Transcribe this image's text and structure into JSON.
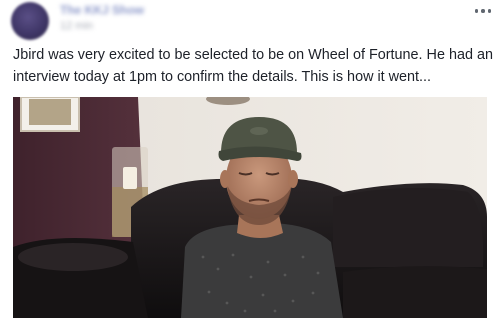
{
  "post": {
    "page_name": "The KKJ Show",
    "timestamp": "12 min",
    "more_icon": "more-horizontal-icon",
    "text": "Jbird was very excited to be selected to be on Wheel of Fortune. He had an interview today at 1pm to confirm the details. This is how it went..."
  },
  "video": {
    "description_icon": "video-thumbnail"
  },
  "colors": {
    "text": "#1d2129",
    "wall": "#ece7e0",
    "accent_wall": "#4b2a34",
    "sofa": "#1a1718",
    "shirt": "#3b3b3c",
    "cap": "#4e5445"
  }
}
